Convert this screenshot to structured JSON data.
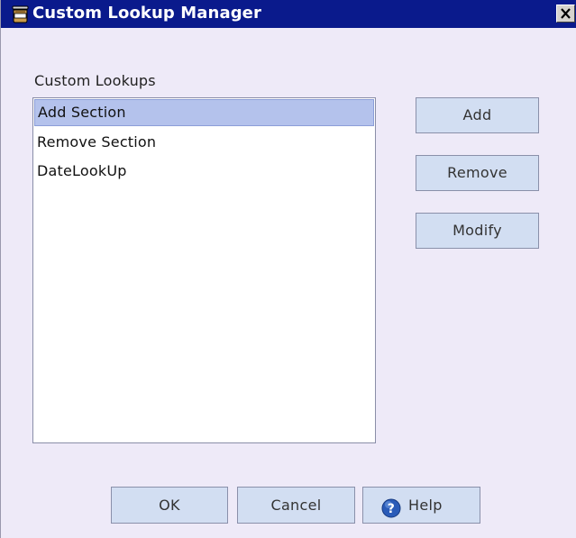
{
  "window": {
    "title": "Custom Lookup Manager",
    "title_icon": "jar-icon",
    "close_icon": "close-icon"
  },
  "lookups": {
    "label": "Custom Lookups",
    "items": [
      {
        "label": "Add Section",
        "selected": true
      },
      {
        "label": "Remove Section",
        "selected": false
      },
      {
        "label": "DateLookUp",
        "selected": false
      }
    ]
  },
  "actions": {
    "add_label": "Add",
    "remove_label": "Remove",
    "modify_label": "Modify"
  },
  "footer": {
    "ok_label": "OK",
    "cancel_label": "Cancel",
    "help_label": "Help",
    "help_icon": "help-icon"
  },
  "colors": {
    "titlebar": "#0a1a8c",
    "dialog_background": "#eeeaf8",
    "selection": "#b4c2ec",
    "button_face": "#d2def2"
  }
}
